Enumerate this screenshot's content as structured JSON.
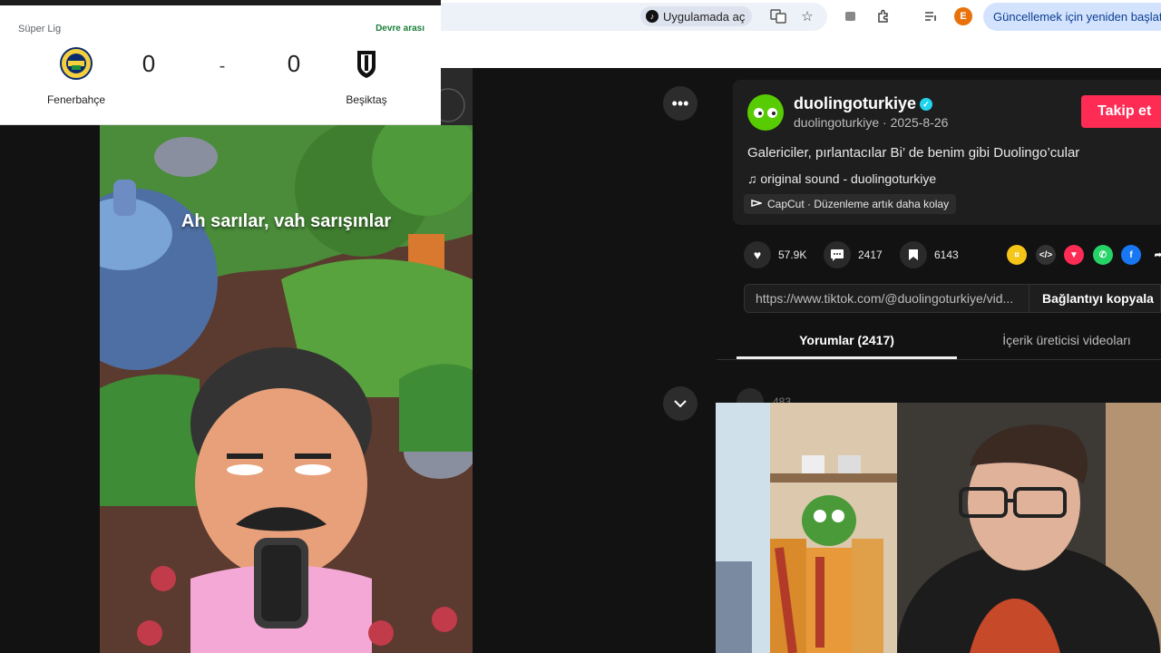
{
  "browser": {
    "open_in_app": "Uygulamada aç",
    "avatar_letter": "E",
    "update_text": "Güncellemek için yeniden başlat"
  },
  "match": {
    "league": "Süper Lig",
    "status": "Devre arası",
    "home_team": "Fenerbahçe",
    "away_team": "Beşiktaş",
    "home_score": "0",
    "away_score": "0",
    "separator": "-"
  },
  "video": {
    "caption": "Ah sarılar, vah sarışınlar"
  },
  "post": {
    "author_name": "duolingoturkiye",
    "author_handle_date": "duolingoturkiye · 2025-8-26",
    "follow_label": "Takip et",
    "description": "Galericiler, pırlantacılar Bi’ de benim gibi Duolingo’cular",
    "sound": "original sound - duolingoturkiye",
    "capcut": "CapCut · Düzenleme artık daha kolay"
  },
  "stats": {
    "likes": "57.9K",
    "comments": "2417",
    "saves": "6143"
  },
  "link": {
    "url": "https://www.tiktok.com/@duolingoturkiye/vid...",
    "copy_label": "Bağlantıyı kopyala"
  },
  "tabs": {
    "comments": "Yorumlar (2417)",
    "creator_videos": "İçerik üreticisi videoları"
  },
  "comment_peek": {
    "count": "483"
  },
  "colors": {
    "tiktok_red": "#fe2c55",
    "duolingo_green": "#58cc02",
    "verified_blue": "#20d5ec"
  }
}
